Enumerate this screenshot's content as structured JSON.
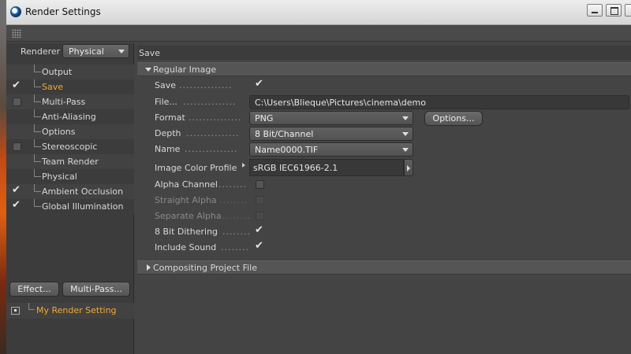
{
  "window": {
    "title": "Render Settings"
  },
  "left": {
    "renderer_label": "Renderer",
    "renderer_value": "Physical",
    "tree": [
      {
        "label": "Output",
        "check": "none",
        "active": false
      },
      {
        "label": "Save",
        "check": "checked",
        "active": true
      },
      {
        "label": "Multi-Pass",
        "check": "box",
        "active": false
      },
      {
        "label": "Anti-Aliasing",
        "check": "none",
        "active": false
      },
      {
        "label": "Options",
        "check": "none",
        "active": false
      },
      {
        "label": "Stereoscopic",
        "check": "box",
        "active": false
      },
      {
        "label": "Team Render",
        "check": "none",
        "active": false
      },
      {
        "label": "Physical",
        "check": "none",
        "active": false
      },
      {
        "label": "Ambient Occlusion",
        "check": "checked",
        "active": false
      },
      {
        "label": "Global Illumination",
        "check": "checked",
        "active": false
      }
    ],
    "effect_button": "Effect...",
    "multipass_button": "Multi-Pass...",
    "render_setting_name": "My Render Setting"
  },
  "right": {
    "section_title": "Save",
    "group_regular": "Regular Image",
    "save_label": "Save",
    "file_label": "File...",
    "file_value": "C:\\Users\\Blieque\\Pictures\\cinema\\demo",
    "format_label": "Format",
    "format_value": "PNG",
    "options_button": "Options...",
    "depth_label": "Depth",
    "depth_value": "8 Bit/Channel",
    "name_label": "Name",
    "name_value": "Name0000.TIF",
    "profile_label": "Image Color Profile",
    "profile_value": "sRGB IEC61966-2.1",
    "alpha_label": "Alpha Channel",
    "straight_alpha_label": "Straight Alpha",
    "separate_alpha_label": "Separate Alpha",
    "dithering_label": "8 Bit Dithering",
    "sound_label": "Include Sound",
    "group_compositing": "Compositing Project File"
  },
  "checkmark": "✔",
  "dots_long": "...............",
  "dots_short": "........",
  "colors": {
    "accent": "#f4a832",
    "panel": "#444444",
    "text": "#d8d8d8"
  }
}
